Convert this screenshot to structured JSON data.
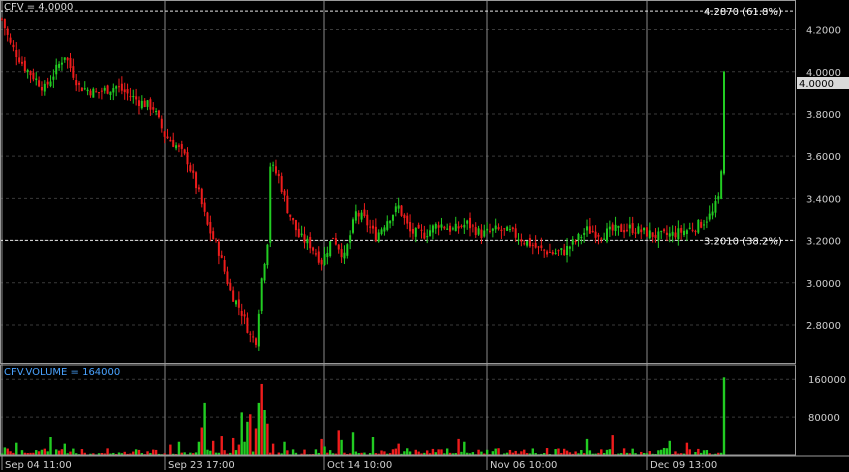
{
  "colors": {
    "background": "#000000",
    "up": "#22cc22",
    "down": "#ee1c1c",
    "grid": "#3a3a3a",
    "fib_line": "#e6e6e6",
    "text": "#d8d8d8",
    "volume_title": "#4aa3ff",
    "last_price_box": "#d9d9d9"
  },
  "price_panel": {
    "title": "CFV = 4.0000",
    "last_price_label": "4.0000"
  },
  "volume_panel": {
    "title": "CFV.VOLUME = 164000"
  },
  "chart_data": [
    {
      "type": "candlestick",
      "title": "CFV = 4.0000",
      "ylim": [
        2.62,
        4.34
      ],
      "y_ticks": [
        "4.2000",
        "4.0000",
        "3.8000",
        "3.6000",
        "3.4000",
        "3.2000",
        "3.0000",
        "2.8000"
      ],
      "y_tick_values": [
        4.2,
        4.0,
        3.8,
        3.6,
        3.4,
        3.2,
        3.0,
        2.8
      ],
      "x_tick_labels": [
        "Sep 04 11:00",
        "Sep 23 17:00",
        "Oct 14 10:00",
        "Nov 06 10:00",
        "Dec 09 13:00"
      ],
      "grid": true,
      "last_price": 4.0,
      "fib_levels": [
        {
          "value": 4.287,
          "label": "4.2870 (61.8%)"
        },
        {
          "value": 3.201,
          "label": "3.2010 (38.2%)"
        }
      ],
      "close_anchors": [
        [
          0,
          4.25
        ],
        [
          3,
          4.13
        ],
        [
          8,
          4.02
        ],
        [
          15,
          3.92
        ],
        [
          22,
          4.08
        ],
        [
          27,
          3.93
        ],
        [
          33,
          3.9
        ],
        [
          40,
          3.93
        ],
        [
          48,
          3.86
        ],
        [
          53,
          3.83
        ],
        [
          57,
          3.7
        ],
        [
          61,
          3.65
        ],
        [
          65,
          3.58
        ],
        [
          69,
          3.42
        ],
        [
          72,
          3.27
        ],
        [
          76,
          3.15
        ],
        [
          80,
          2.96
        ],
        [
          84,
          2.86
        ],
        [
          87,
          2.75
        ],
        [
          89,
          2.73
        ],
        [
          91,
          3.02
        ],
        [
          93,
          3.2
        ],
        [
          94,
          3.56
        ],
        [
          97,
          3.5
        ],
        [
          100,
          3.35
        ],
        [
          104,
          3.22
        ],
        [
          108,
          3.18
        ],
        [
          112,
          3.1
        ],
        [
          116,
          3.22
        ],
        [
          120,
          3.12
        ],
        [
          124,
          3.33
        ],
        [
          127,
          3.3
        ],
        [
          131,
          3.22
        ],
        [
          135,
          3.3
        ],
        [
          139,
          3.36
        ],
        [
          143,
          3.24
        ],
        [
          148,
          3.23
        ],
        [
          153,
          3.28
        ],
        [
          158,
          3.25
        ],
        [
          163,
          3.28
        ],
        [
          168,
          3.23
        ],
        [
          173,
          3.25
        ],
        [
          178,
          3.24
        ],
        [
          183,
          3.2
        ],
        [
          188,
          3.16
        ],
        [
          193,
          3.14
        ],
        [
          197,
          3.15
        ],
        [
          201,
          3.2
        ],
        [
          205,
          3.25
        ],
        [
          210,
          3.23
        ],
        [
          215,
          3.25
        ],
        [
          220,
          3.26
        ],
        [
          225,
          3.24
        ],
        [
          230,
          3.22
        ],
        [
          235,
          3.23
        ],
        [
          240,
          3.25
        ],
        [
          245,
          3.28
        ],
        [
          249,
          3.33
        ],
        [
          251,
          3.4
        ],
        [
          252,
          3.55
        ],
        [
          253,
          4.0
        ]
      ],
      "volume": {
        "title": "CFV.VOLUME = 164000",
        "ylim": [
          0,
          190000
        ],
        "y_ticks": [
          "160000",
          "80000"
        ],
        "y_tick_values": [
          160000,
          80000
        ],
        "last_value": 164000,
        "spikes": [
          [
            1,
            16000
          ],
          [
            5,
            26000
          ],
          [
            17,
            38000
          ],
          [
            22,
            24000
          ],
          [
            47,
            12000
          ],
          [
            59,
            22000
          ],
          [
            62,
            28000
          ],
          [
            69,
            28000
          ],
          [
            70,
            58000
          ],
          [
            71,
            110000
          ],
          [
            74,
            30000
          ],
          [
            77,
            40000
          ],
          [
            81,
            36000
          ],
          [
            83,
            22000
          ],
          [
            84,
            90000
          ],
          [
            85,
            28000
          ],
          [
            86,
            70000
          ],
          [
            87,
            86000
          ],
          [
            89,
            56000
          ],
          [
            90,
            110000
          ],
          [
            91,
            150000
          ],
          [
            92,
            95000
          ],
          [
            93,
            66000
          ],
          [
            95,
            24000
          ],
          [
            99,
            28000
          ],
          [
            112,
            34000
          ],
          [
            113,
            18000
          ],
          [
            118,
            52000
          ],
          [
            119,
            32000
          ],
          [
            123,
            48000
          ],
          [
            130,
            38000
          ],
          [
            139,
            24000
          ],
          [
            160,
            34000
          ],
          [
            162,
            28000
          ],
          [
            205,
            34000
          ],
          [
            214,
            42000
          ],
          [
            234,
            30000
          ],
          [
            240,
            26000
          ],
          [
            253,
            164000
          ]
        ]
      }
    }
  ]
}
